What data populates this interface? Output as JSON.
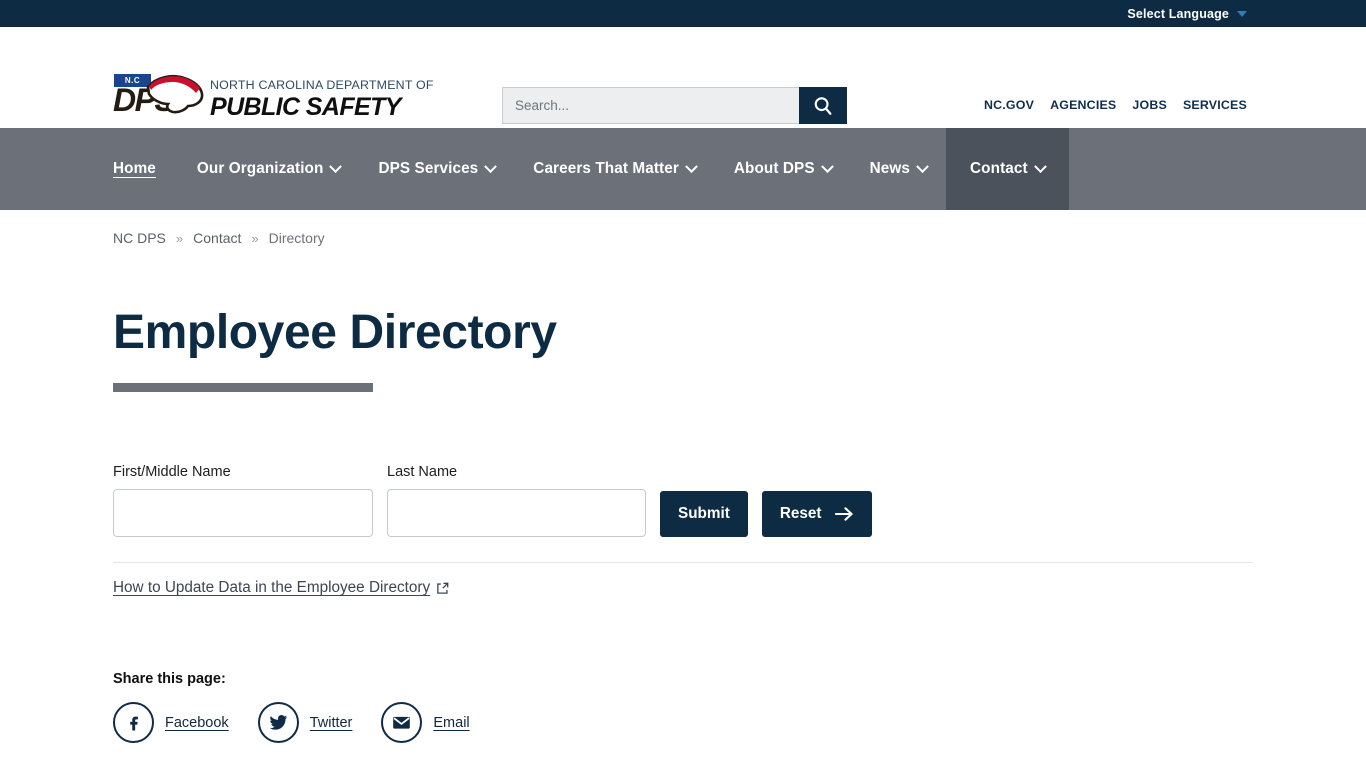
{
  "language_bar": {
    "select_language_label": "Select Language",
    "caret_icon": "chevron-down-icon"
  },
  "masthead": {
    "logo": {
      "badge_text": "N.C",
      "acronym": "DPS",
      "line1": "NORTH CAROLINA DEPARTMENT OF",
      "line2": "PUBLIC SAFETY"
    },
    "search": {
      "placeholder": "Search...",
      "value": "",
      "button_icon": "search-icon"
    },
    "utility_links": [
      {
        "label": "NC.GOV"
      },
      {
        "label": "AGENCIES"
      },
      {
        "label": "JOBS"
      },
      {
        "label": "SERVICES"
      }
    ]
  },
  "main_nav": {
    "items": [
      {
        "label": "Home",
        "has_caret": false,
        "active": true,
        "open": false
      },
      {
        "label": "Our Organization",
        "has_caret": true,
        "active": false,
        "open": false
      },
      {
        "label": "DPS Services",
        "has_caret": true,
        "active": false,
        "open": false
      },
      {
        "label": "Careers That Matter",
        "has_caret": true,
        "active": false,
        "open": false
      },
      {
        "label": "About DPS",
        "has_caret": true,
        "active": false,
        "open": false
      },
      {
        "label": "News",
        "has_caret": true,
        "active": false,
        "open": false
      },
      {
        "label": "Contact",
        "has_caret": true,
        "active": false,
        "open": true
      }
    ]
  },
  "breadcrumb": {
    "separator": "»",
    "items": [
      {
        "label": "NC DPS",
        "current": false
      },
      {
        "label": "Contact",
        "current": false
      },
      {
        "label": "Directory",
        "current": true
      }
    ]
  },
  "page": {
    "title": "Employee Directory"
  },
  "form": {
    "first_name": {
      "label": "First/Middle Name",
      "value": "",
      "placeholder": ""
    },
    "last_name": {
      "label": "Last Name",
      "value": "",
      "placeholder": ""
    },
    "submit_label": "Submit",
    "reset_label": "Reset",
    "reset_icon": "arrow-right-icon"
  },
  "update_link": {
    "label": "How to Update Data in the Employee Directory",
    "icon": "external-link-icon"
  },
  "share": {
    "title": "Share this page:",
    "items": [
      {
        "label": "Facebook",
        "icon": "facebook-icon"
      },
      {
        "label": "Twitter",
        "icon": "twitter-icon"
      },
      {
        "label": "Email",
        "icon": "email-icon"
      }
    ]
  },
  "colors": {
    "navy": "#0d2c43",
    "nav_gray": "#6b7079",
    "nav_active_gray": "#4c525b",
    "accent_blue": "#2f7fb5",
    "logo_blue": "#17458f",
    "logo_red": "#c8102e"
  }
}
